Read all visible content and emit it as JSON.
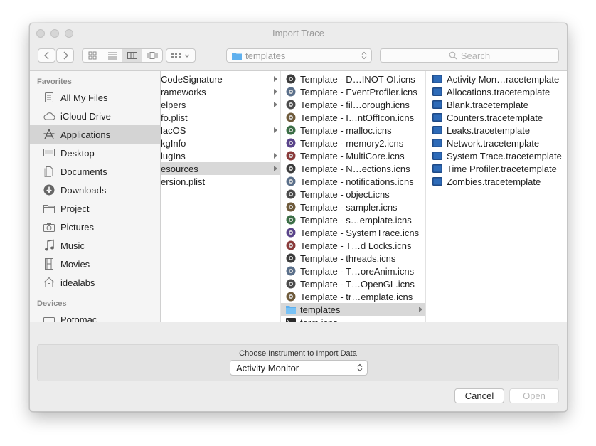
{
  "window": {
    "title": "Import Trace"
  },
  "toolbar": {
    "path_label": "templates",
    "search_placeholder": "Search"
  },
  "sidebar": {
    "favorites_header": "Favorites",
    "favorites": [
      {
        "label": "All My Files",
        "icon": "all-files-icon"
      },
      {
        "label": "iCloud Drive",
        "icon": "cloud-icon"
      },
      {
        "label": "Applications",
        "icon": "applications-icon",
        "selected": true
      },
      {
        "label": "Desktop",
        "icon": "desktop-icon"
      },
      {
        "label": "Documents",
        "icon": "documents-icon"
      },
      {
        "label": "Downloads",
        "icon": "downloads-icon"
      },
      {
        "label": "Project",
        "icon": "folder-icon"
      },
      {
        "label": "Pictures",
        "icon": "camera-icon"
      },
      {
        "label": "Music",
        "icon": "music-icon"
      },
      {
        "label": "Movies",
        "icon": "film-icon"
      },
      {
        "label": "idealabs",
        "icon": "home-icon"
      }
    ],
    "devices_header": "Devices",
    "devices": [
      {
        "label": "Potomac",
        "icon": "drive-icon"
      }
    ]
  },
  "columns": {
    "col1": [
      {
        "label": "CodeSignature",
        "arrow": true
      },
      {
        "label": "rameworks",
        "arrow": true
      },
      {
        "label": "elpers",
        "arrow": true
      },
      {
        "label": "fo.plist",
        "arrow": false
      },
      {
        "label": "lacOS",
        "arrow": true
      },
      {
        "label": "kgInfo",
        "arrow": false
      },
      {
        "label": "lugIns",
        "arrow": true
      },
      {
        "label": "esources",
        "arrow": true,
        "selected": true
      },
      {
        "label": "ersion.plist",
        "arrow": false
      }
    ],
    "col2": [
      {
        "label": "Template - D…INOT OI.icns"
      },
      {
        "label": "Template - EventProfiler.icns"
      },
      {
        "label": "Template - fil…orough.icns"
      },
      {
        "label": "Template - I…ntOffIcon.icns"
      },
      {
        "label": "Template - malloc.icns"
      },
      {
        "label": "Template - memory2.icns"
      },
      {
        "label": "Template - MultiCore.icns"
      },
      {
        "label": "Template - N…ections.icns"
      },
      {
        "label": "Template - notifications.icns"
      },
      {
        "label": "Template - object.icns"
      },
      {
        "label": "Template - sampler.icns"
      },
      {
        "label": "Template - s…emplate.icns"
      },
      {
        "label": "Template - SystemTrace.icns"
      },
      {
        "label": "Template - T…d Locks.icns"
      },
      {
        "label": "Template - threads.icns"
      },
      {
        "label": "Template - T…oreAnim.icns"
      },
      {
        "label": "Template - T…OpenGL.icns"
      },
      {
        "label": "Template - tr…emplate.icns"
      },
      {
        "label": "templates",
        "folder": true,
        "selected": true,
        "arrow": true
      },
      {
        "label": "term.icns"
      }
    ],
    "col3": [
      {
        "label": "Activity Mon…racetemplate"
      },
      {
        "label": "Allocations.tracetemplate"
      },
      {
        "label": "Blank.tracetemplate"
      },
      {
        "label": "Counters.tracetemplate"
      },
      {
        "label": "Leaks.tracetemplate"
      },
      {
        "label": "Network.tracetemplate"
      },
      {
        "label": "System Trace.tracetemplate"
      },
      {
        "label": "Time Profiler.tracetemplate"
      },
      {
        "label": "Zombies.tracetemplate"
      }
    ]
  },
  "import": {
    "label": "Choose Instrument to Import Data",
    "selected": "Activity Monitor"
  },
  "buttons": {
    "cancel": "Cancel",
    "open": "Open"
  },
  "colors": {
    "selection": "#d4d4d4",
    "folder": "#5fb0ee",
    "template_icon": "#1f4a86"
  }
}
